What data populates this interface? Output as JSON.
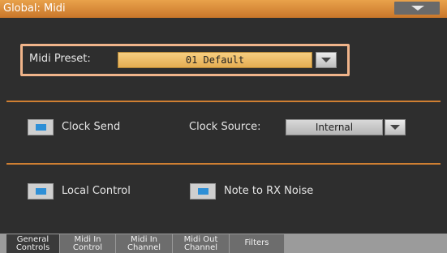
{
  "window": {
    "title": "Global: Midi",
    "menu_icon": "chevron-down-icon"
  },
  "midi_preset": {
    "label": "Midi Preset:",
    "value": "01 Default"
  },
  "clock_send": {
    "label": "Clock Send",
    "checked": true
  },
  "clock_source": {
    "label": "Clock Source:",
    "value": "Internal"
  },
  "local_control": {
    "label": "Local Control",
    "checked": true
  },
  "note_to_rx_noise": {
    "label": "Note to RX Noise",
    "checked": true
  },
  "tabs": [
    {
      "line1": "General",
      "line2": "Controls",
      "active": true
    },
    {
      "line1": "Midi In",
      "line2": "Control",
      "active": false
    },
    {
      "line1": "Midi In",
      "line2": "Channel",
      "active": false
    },
    {
      "line1": "Midi Out",
      "line2": "Channel",
      "active": false
    },
    {
      "line1": "Filters",
      "line2": "",
      "active": false
    }
  ],
  "colors": {
    "accent": "#d98a3a",
    "field": "#f2c26b",
    "checkbox_fill": "#2e8fd6"
  }
}
